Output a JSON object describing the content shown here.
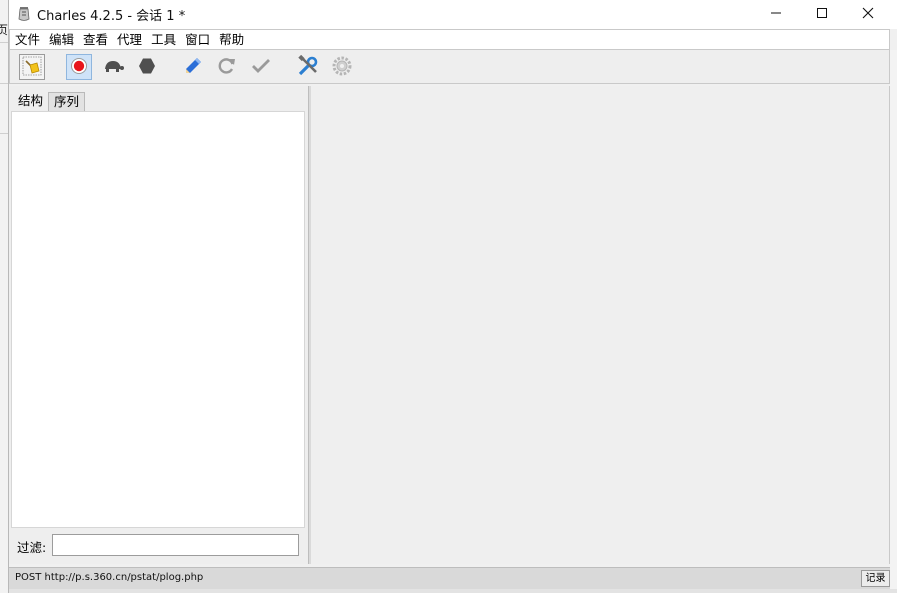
{
  "background_window": {
    "fragment_top": "页",
    "fragment_bottom": "-"
  },
  "window": {
    "title": "Charles 4.2.5 - 会话 1 *",
    "app_icon": "charles-jar-icon",
    "controls": {
      "minimize_icon": "minimize-icon",
      "maximize_icon": "maximize-icon",
      "close_icon": "close-icon"
    }
  },
  "menu": {
    "items": [
      {
        "label": "文件"
      },
      {
        "label": "编辑"
      },
      {
        "label": "查看"
      },
      {
        "label": "代理"
      },
      {
        "label": "工具"
      },
      {
        "label": "窗口"
      },
      {
        "label": "帮助"
      }
    ]
  },
  "toolbar": {
    "buttons": [
      {
        "icon": "broom-icon",
        "state": "normal"
      },
      {
        "icon": "record-icon",
        "state": "active"
      },
      {
        "icon": "turtle-throttle-icon",
        "state": "normal"
      },
      {
        "icon": "stop-hexagon-icon",
        "state": "normal"
      },
      {
        "icon": "pencil-compose-icon",
        "state": "normal"
      },
      {
        "icon": "refresh-repeat-icon",
        "state": "disabled"
      },
      {
        "icon": "checkmark-validate-icon",
        "state": "disabled"
      },
      {
        "icon": "tools-wrench-icon",
        "state": "normal"
      },
      {
        "icon": "settings-gear-icon",
        "state": "disabled"
      }
    ]
  },
  "left_panel": {
    "tabs": [
      {
        "label": "结构",
        "active": true
      },
      {
        "label": "序列",
        "active": false
      }
    ],
    "filter_label": "过滤:",
    "filter_value": ""
  },
  "status_bar": {
    "text": "POST http://p.s.360.cn/pstat/plog.php",
    "button_label": "记录"
  },
  "colors": {
    "record_red": "#e8151b",
    "toolbar_icon_gray": "#555555",
    "pencil_blue": "#2b6ed8",
    "tools_blue": "#2b7fd1",
    "active_highlight": "#cfe3f8"
  }
}
